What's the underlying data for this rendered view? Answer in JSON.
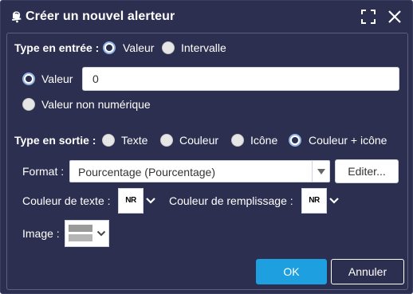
{
  "window": {
    "title": "Créer un nouvel alerteur",
    "icons": {
      "title": "alert-bell-icon",
      "maximize": "maximize-icon",
      "close": "close-icon"
    }
  },
  "input_type": {
    "label": "Type en entrée :",
    "options": [
      {
        "label": "Valeur",
        "checked": true
      },
      {
        "label": "Intervalle",
        "checked": false
      }
    ]
  },
  "value_section": {
    "value_radio_label": "Valeur",
    "value_input": "0",
    "non_numeric_label": "Valeur non numérique"
  },
  "output_type": {
    "label": "Type en sortie :",
    "options": [
      {
        "label": "Texte",
        "checked": false
      },
      {
        "label": "Couleur",
        "checked": false
      },
      {
        "label": "Icône",
        "checked": false
      },
      {
        "label": "Couleur + icône",
        "checked": true
      }
    ]
  },
  "format": {
    "label": "Format :",
    "selected": "Pourcentage (Pourcentage)",
    "edit_button": "Editer..."
  },
  "colors": {
    "text_color_label": "Couleur de texte :",
    "text_color_swatch": "NR",
    "fill_color_label": "Couleur de remplissage :",
    "fill_color_swatch": "NR"
  },
  "image": {
    "label": "Image :"
  },
  "footer": {
    "ok_button": "OK",
    "cancel_button": "Annuler"
  },
  "theme": {
    "background": "#2c2f4f",
    "accent": "#1e9fe0",
    "text": "#ffffff"
  }
}
